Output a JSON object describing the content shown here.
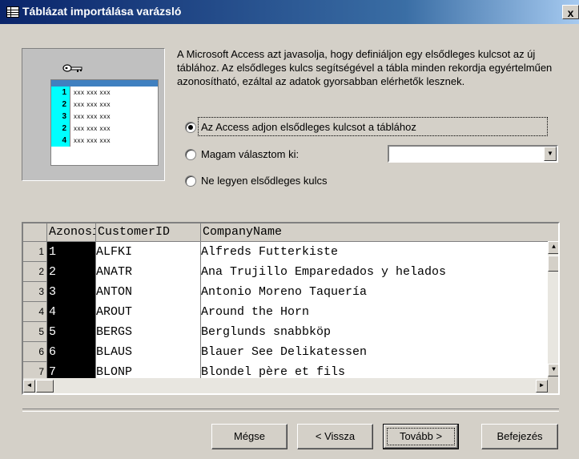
{
  "window": {
    "title": "Táblázat importálása varázsló",
    "close_glyph": "x"
  },
  "illustration": {
    "row_numbers": [
      "1",
      "2",
      "3",
      "2",
      "4"
    ],
    "placeholder": "xxx xxx xxx"
  },
  "description": "A Microsoft Access azt javasolja, hogy definiáljon egy elsődleges kulcsot az új táblához. Az elsődleges kulcs segítségével a tábla minden rekordja egyértelműen azonosítható, ezáltal az adatok gyorsabban elérhetők lesznek.",
  "options": {
    "auto": "Az Access adjon elsődleges kulcsot a táblához",
    "choose": "Magam választom ki:",
    "none": "Ne legyen elsődleges kulcs",
    "selected": "auto"
  },
  "grid": {
    "headers": [
      "Azonosító",
      "CustomerID",
      "CompanyName"
    ],
    "rows": [
      {
        "n": "1",
        "id": "1",
        "cust": "ALFKI",
        "company": "Alfreds Futterkiste"
      },
      {
        "n": "2",
        "id": "2",
        "cust": "ANATR",
        "company": "Ana Trujillo Emparedados y helados"
      },
      {
        "n": "3",
        "id": "3",
        "cust": "ANTON",
        "company": "Antonio Moreno Taquería"
      },
      {
        "n": "4",
        "id": "4",
        "cust": "AROUT",
        "company": "Around the Horn"
      },
      {
        "n": "5",
        "id": "5",
        "cust": "BERGS",
        "company": "Berglunds snabbköp"
      },
      {
        "n": "6",
        "id": "6",
        "cust": "BLAUS",
        "company": "Blauer See Delikatessen"
      },
      {
        "n": "7",
        "id": "7",
        "cust": "BLONP",
        "company": "Blondel père et fils"
      }
    ]
  },
  "buttons": {
    "cancel": "Mégse",
    "back": "< Vissza",
    "next": "Tovább >",
    "finish": "Befejezés"
  }
}
